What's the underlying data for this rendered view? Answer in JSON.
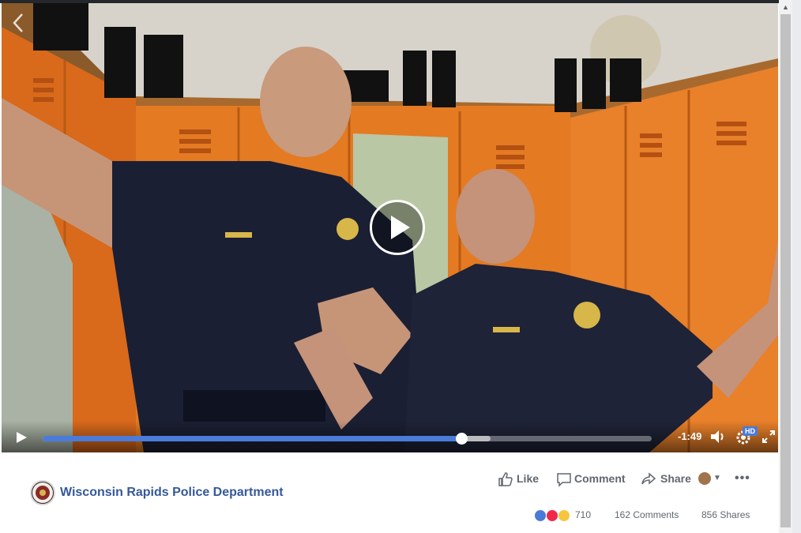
{
  "video": {
    "time_remaining": "-1:49",
    "progress_fraction": 0.688,
    "buffered_fraction": 0.735,
    "hd_label": "HD",
    "accent_color": "#4a7bd8"
  },
  "post": {
    "page_name": "Wisconsin Rapids Police Department",
    "actions": {
      "like": "Like",
      "comment": "Comment",
      "share": "Share"
    },
    "stats": {
      "reactions": "710",
      "comments": "162 Comments",
      "shares": "856 Shares"
    },
    "link_color": "#365899"
  },
  "icons": [
    "back-arrow-icon",
    "play-icon",
    "volume-icon",
    "settings-gear-icon",
    "fullscreen-icon",
    "like-icon",
    "comment-icon",
    "share-icon",
    "more-options-icon",
    "like-reaction-icon",
    "love-reaction-icon",
    "haha-reaction-icon"
  ]
}
